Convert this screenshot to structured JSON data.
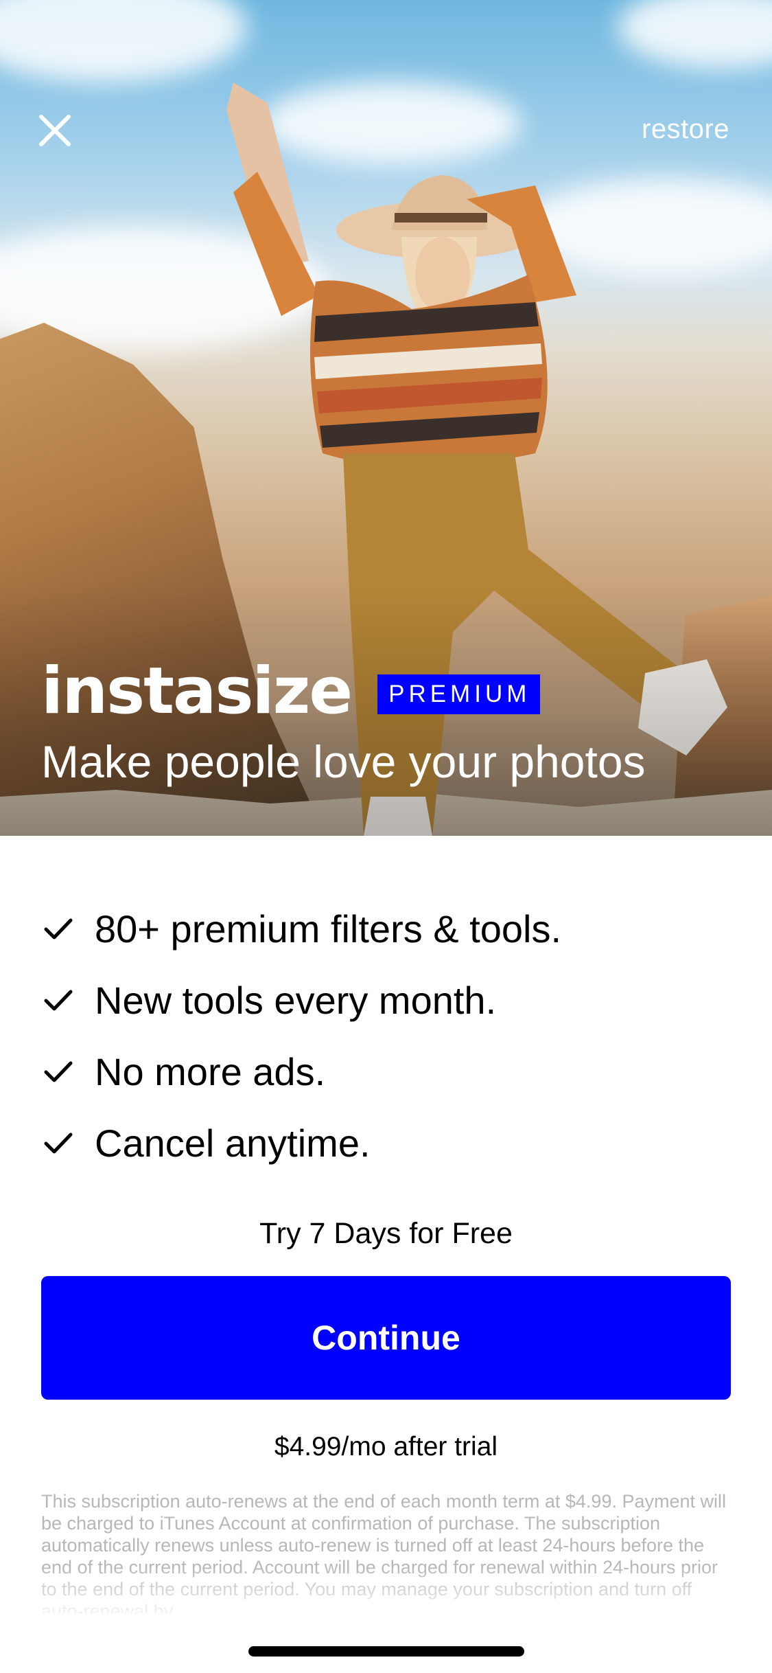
{
  "header": {
    "restore_label": "restore"
  },
  "brand": {
    "logo_text": "instasize",
    "badge_label": "PREMIUM",
    "tagline": "Make people love your photos"
  },
  "features": [
    {
      "label": "80+ premium filters & tools."
    },
    {
      "label": "New tools every month."
    },
    {
      "label": "No more ads."
    },
    {
      "label": "Cancel anytime."
    }
  ],
  "cta": {
    "trial_text": "Try 7 Days for Free",
    "continue_label": "Continue",
    "price_text": "$4.99/mo after trial"
  },
  "legal": {
    "text": "This subscription auto-renews at the end of each month term at $4.99. Payment will be charged to iTunes Account at confirmation of purchase. The subscription automatically renews unless auto-renew is turned off at least 24-hours before the end of the current period. Account will be charged for renewal within 24-hours prior to the end of the current period. You may manage your subscription and turn off auto-renewal by"
  },
  "colors": {
    "accent": "#0000ff",
    "legal_text": "#b7b7bb"
  },
  "icons": {
    "close": "close-icon",
    "check": "check-icon"
  }
}
